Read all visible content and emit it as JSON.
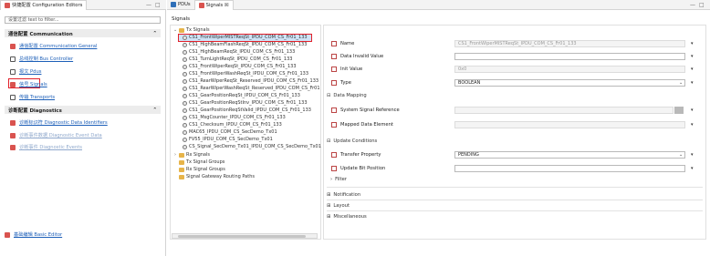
{
  "left_panel": {
    "tab_label": "快捷配置 Configuration Editors",
    "filter_placeholder": "设置过滤 text to filter...",
    "sections": [
      {
        "title": "通信配置 Communication",
        "items": [
          {
            "label": "通信配置 Communication General",
            "icon": "gear-icon"
          },
          {
            "label": "总线控制 Bus Controller",
            "icon": "bus-icon"
          },
          {
            "label": "报文 Pdus",
            "icon": "pdu-icon"
          },
          {
            "label": "信号 Signals",
            "icon": "signal-icon"
          },
          {
            "label": "传输 Transports",
            "icon": "transport-icon"
          }
        ]
      },
      {
        "title": "诊断配置 Diagnostics",
        "items": [
          {
            "label": "诊断标识符 Diagnostic Data Identifiers",
            "icon": "did-icon"
          },
          {
            "label": "诊断事件数据 Diagnostic Event Data",
            "icon": "event-data-icon"
          },
          {
            "label": "诊断事件 Diagnostic Events",
            "icon": "event-icon"
          }
        ]
      }
    ],
    "footer_link": "基础编辑 Basic Editor"
  },
  "editor_tabs": {
    "tabs": [
      {
        "label": "PDUs"
      },
      {
        "label": "Signals ☒"
      }
    ]
  },
  "tree": {
    "title": "Signals",
    "root": "Tx Signals",
    "tx_signals": [
      "CS1_FrontWiperMISTReqSt_IPDU_COM_CS_Fr01_133",
      "CS1_HighBeamFlashReqSt_IPDU_COM_CS_Fr01_133",
      "CS1_HighBeamReqSt_IPDU_COM_CS_Fr01_133",
      "CS1_TurnLightReqSt_IPDU_COM_CS_Fr01_133",
      "CS1_FrontWiperReqSt_IPDU_COM_CS_Fr01_133",
      "CS1_FrontWiperWashReqSt_IPDU_COM_CS_Fr01_133",
      "CS1_RearWiperReqSt_Reserved_IPDU_COM_CS_Fr01_133",
      "CS1_RearWiperWashReqSt_Reserved_IPDU_COM_CS_Fr01",
      "CS1_GearPositionReqSt_IPDU_COM_CS_Fr01_133",
      "CS1_GearPositionReqStInv_IPDU_COM_CS_Fr01_133",
      "CS1_GearPositionReqStValid_IPDU_COM_CS_Fr01_133",
      "CS1_MsgCounter_IPDU_COM_CS_Fr01_133",
      "CS1_Checksum_IPDU_COM_CS_Fr01_133",
      "MAC65_IPDU_COM_CS_SecDemo_Tx01",
      "FV55_IPDU_COM_CS_SecDemo_Tx01",
      "CS_Signal_SecDemo_Tx01_IPDU_COM_CS_SecDemo_Tx01"
    ],
    "groups": [
      "Rx Signals",
      "Tx Signal Groups",
      "Rx Signal Groups",
      "Signal Gateway Routing Paths"
    ]
  },
  "properties": {
    "name_label": "Name",
    "name_value": "CS1_FrontWiperMISTReqSt_IPDU_COM_CS_Fr01_133",
    "data_invalid_label": "Data Invalid Value",
    "data_invalid_value": "",
    "init_label": "Init Value",
    "init_value": "0x0",
    "type_label": "Type",
    "type_value": "BOOLEAN",
    "data_mapping": "Data Mapping",
    "system_signal_label": "System Signal Reference",
    "system_signal_value": "",
    "mapped_element_label": "Mapped Data Element",
    "mapped_element_value": "",
    "update_conditions": "Update Conditions",
    "transfer_label": "Transfer Property",
    "transfer_value": "PENDING",
    "update_bit_label": "Update Bit Position",
    "update_bit_value": "",
    "filter": "Filter",
    "notification": "Notification",
    "layout": "Layout",
    "misc": "Miscellaneous"
  },
  "colors": {
    "highlight": "#e3202a",
    "link": "#1d5fb8",
    "selected_row": "#cfe3f7"
  }
}
